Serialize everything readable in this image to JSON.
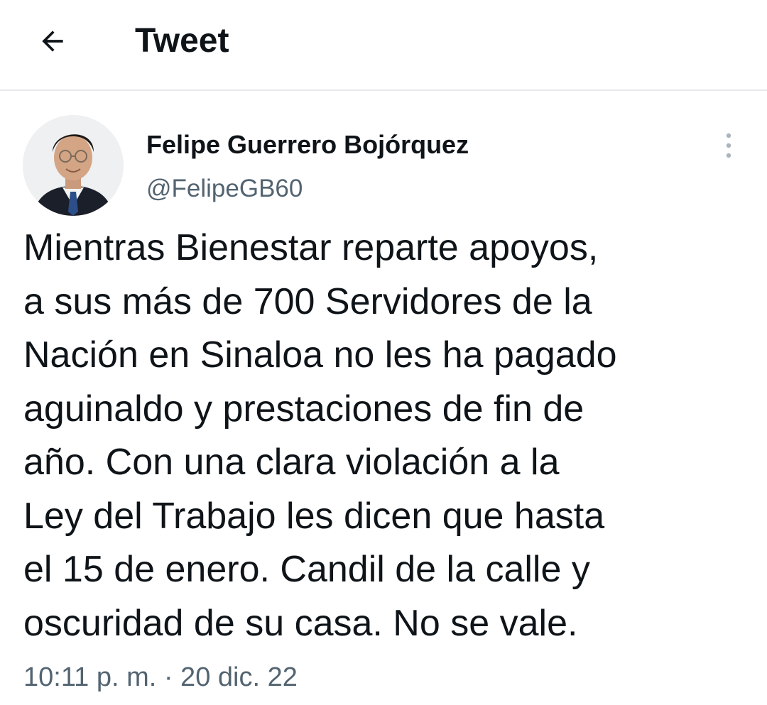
{
  "header": {
    "back_icon": "arrow-left-icon",
    "title": "Tweet"
  },
  "tweet": {
    "author_name": "Felipe Guerrero Bojórquez",
    "author_handle": "@FelipeGB60",
    "more_icon": "vertical-dots-icon",
    "text": "Mientras Bienestar reparte apoyos,\na sus más de 700 Servidores de la\nNación en Sinaloa no les ha pagado\naguinaldo y prestaciones de fin de\naño. Con una clara violación a la\nLey del Trabajo les dicen que hasta\nel 15 de enero. Candil de la calle y\noscuridad de su casa. No se vale.",
    "timestamp": "10:11 p. m. · 20 dic. 22"
  },
  "colors": {
    "text_primary": "#0f1419",
    "text_secondary": "#536471",
    "divider": "#e6e8ea"
  }
}
